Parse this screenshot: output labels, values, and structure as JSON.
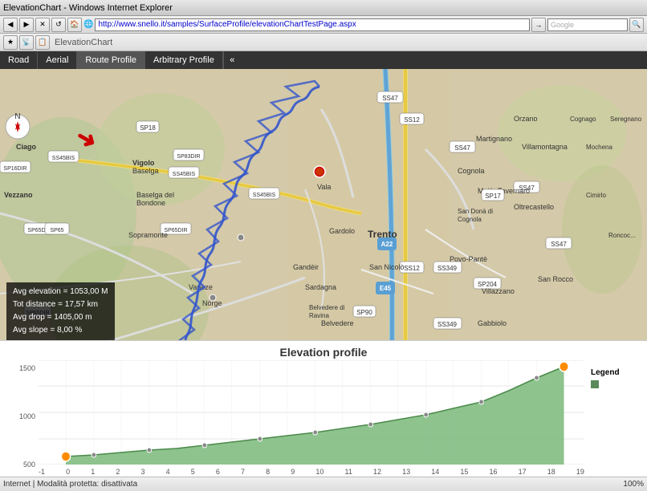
{
  "browser": {
    "title": "ElevationChart - Windows Internet Explorer",
    "address": "http://www.snello.it/samples/SurfaceProfile/elevationChartTestPage.aspx",
    "search_placeholder": "Google",
    "logo": "ElevationChart"
  },
  "tabs": [
    {
      "id": "road",
      "label": "Road"
    },
    {
      "id": "aerial",
      "label": "Aerial"
    },
    {
      "id": "route-profile",
      "label": "Route Profile"
    },
    {
      "id": "arbitrary-profile",
      "label": "Arbitrary Profile"
    }
  ],
  "stats": {
    "avg_elevation_label": "Avg elevation = 1053,00 M",
    "tot_distance_label": "Tot distance = 17,57 km",
    "avg_drop_label": "Avg drop = 1405,00 m",
    "avg_slope_label": "Avg slope = 8,00 %"
  },
  "elevation": {
    "title": "Elevation profile",
    "legend_label": "Legend",
    "y_axis": [
      "1500",
      "1000",
      "500"
    ],
    "x_axis": [
      "-1",
      "0",
      "1",
      "2",
      "3",
      "4",
      "5",
      "6",
      "7",
      "8",
      "9",
      "10",
      "11",
      "12",
      "13",
      "14",
      "15",
      "16",
      "17",
      "18",
      "19"
    ]
  },
  "status_bar": {
    "left": "Internet | Modalità protetta: disattivata",
    "zoom": "100%"
  },
  "colors": {
    "accent_red": "#cc0000",
    "map_bg": "#c8b896",
    "elevation_fill": "#7ab87a",
    "route_blue": "#3355cc"
  }
}
